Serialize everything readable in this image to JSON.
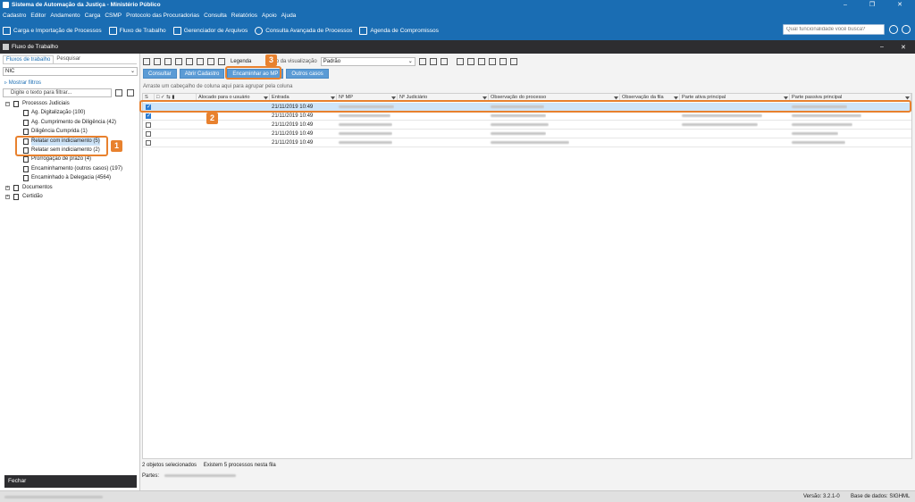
{
  "window": {
    "title": "Sistema de Automação da Justiça - Ministério Público",
    "controls": [
      "–",
      "❐",
      "✕"
    ]
  },
  "menu": [
    "Cadastro",
    "Editor",
    "Andamento",
    "Carga",
    "CSMP",
    "Protocolo das Procuradorias",
    "Consulta",
    "Relatórios",
    "Apoio",
    "Ajuda"
  ],
  "toolbar": {
    "items": [
      "Carga e Importação de Processos",
      "Fluxo de Trabalho",
      "Gerenciador de Arquivos",
      "Consulta Avançada de Processos",
      "Agenda de Compromissos"
    ],
    "search_placeholder": "Qual funcionalidade você busca?"
  },
  "docbar": {
    "title": "Fluxo de Trabalho",
    "controls": [
      "–",
      "✕"
    ]
  },
  "left": {
    "tabs": [
      "Fluxos de trabalho",
      "Pesquisar"
    ],
    "select_value": "NIC",
    "show_filters": "Mostrar filtros",
    "filter_placeholder": "Digite o texto para filtrar...",
    "tree": [
      {
        "label": "Processos Judiciais",
        "level": 0,
        "exp": "–"
      },
      {
        "label": "Ag. Digitalização (100)",
        "level": 1
      },
      {
        "label": "Ag. Cumprimento de Diligência (42)",
        "level": 1
      },
      {
        "label": "Diligência Cumprida (1)",
        "level": 1
      },
      {
        "label": "Relatar com indiciamento (5)",
        "level": 1,
        "selected": true
      },
      {
        "label": "Relatar sem indiciamento (2)",
        "level": 1
      },
      {
        "label": "Prorrogação de prazo (4)",
        "level": 1
      },
      {
        "label": "Encaminhamento (outros casos) (197)",
        "level": 1
      },
      {
        "label": "Encaminhado à Delegacia (4564)",
        "level": 1
      },
      {
        "label": "Documentos",
        "level": 0,
        "exp": "+"
      },
      {
        "label": "Certidão",
        "level": 0,
        "exp": "+"
      }
    ],
    "close_label": "Fechar"
  },
  "right": {
    "legend": "Legenda",
    "style_label": "Estilo da visualização",
    "style_value": "Padrão",
    "actions": [
      "Consultar",
      "Abrir Cadastro",
      "Encaminhar ao MP",
      "Outros casos"
    ],
    "group_hint": "Arraste um cabeçalho de coluna aqui para agrupar pela coluna",
    "columns": [
      "S",
      "Alocado para o usuário",
      "Entrada",
      "Nº MP",
      "Nº Judiciário",
      "Observação do processo",
      "Observação da fila",
      "Parte ativa principal",
      "Parte passiva principal"
    ],
    "rows": [
      {
        "checked": true,
        "date": "21/11/2019 10:49"
      },
      {
        "checked": true,
        "date": "21/11/2019 10:49"
      },
      {
        "checked": false,
        "date": "21/11/2019 10:49"
      },
      {
        "checked": false,
        "date": "21/11/2019 10:49"
      },
      {
        "checked": false,
        "date": "21/11/2019 10:49"
      }
    ],
    "status_selected": "2 objetos selecionados",
    "status_count": "Existem 5 processos nesta fila",
    "parts_label": "Partes:"
  },
  "footer": {
    "version": "Versão: 3.2.1-0",
    "database": "Base de dados: SIGHML"
  },
  "markers": [
    "1",
    "2",
    "3"
  ],
  "colors": {
    "accent": "#1a6db3",
    "highlight": "#e8812e",
    "selection": "#cfe5f8"
  }
}
